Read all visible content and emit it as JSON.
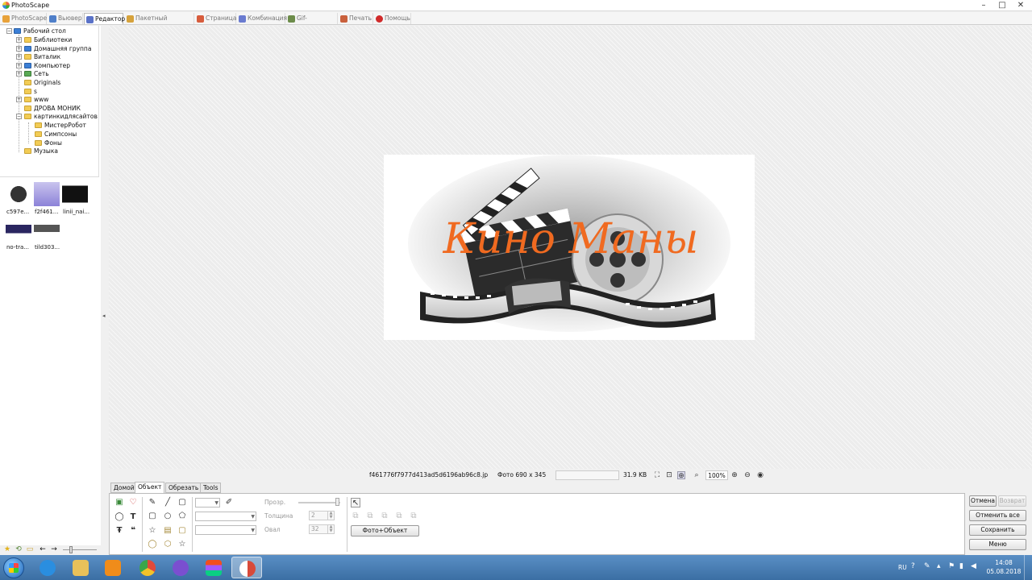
{
  "window": {
    "title": "PhotoScape",
    "min": "–",
    "max": "□",
    "close": "✕"
  },
  "tabs": [
    {
      "label": "PhotoScape",
      "icon": "photoscape-icon",
      "color": "#e8a23a"
    },
    {
      "label": "Вьювер",
      "icon": "viewer-icon",
      "color": "#4f7fc9"
    },
    {
      "label": "Редактор",
      "icon": "editor-icon",
      "color": "#5a72c8"
    },
    {
      "label": "Пакетный редактор",
      "icon": "batch-icon",
      "color": "#d6a23b"
    },
    {
      "label": "Страница",
      "icon": "page-icon",
      "color": "#d75c3c"
    },
    {
      "label": "Комбинация",
      "icon": "combine-icon",
      "color": "#6a7bd0"
    },
    {
      "label": "Gif-Анимация",
      "icon": "gif-icon",
      "color": "#6c8c4a"
    },
    {
      "label": "Печать",
      "icon": "print-icon",
      "color": "#c9603c"
    },
    {
      "label": "Помощь",
      "icon": "help-icon",
      "color": "#d02a2a"
    }
  ],
  "tree": [
    {
      "label": "Рабочий стол",
      "icon": "desktop-icon"
    },
    {
      "label": "Библиотеки",
      "icon": "libraries-icon"
    },
    {
      "label": "Домашняя группа",
      "icon": "homegroup-icon"
    },
    {
      "label": "Виталик",
      "icon": "user-folder-icon"
    },
    {
      "label": "Компьютер",
      "icon": "computer-icon"
    },
    {
      "label": "Сеть",
      "icon": "network-icon"
    },
    {
      "label": "Originals",
      "icon": "folder-icon"
    },
    {
      "label": "s",
      "icon": "folder-icon"
    },
    {
      "label": "www",
      "icon": "folder-icon"
    },
    {
      "label": "ДРОВА МОНИК",
      "icon": "folder-icon"
    },
    {
      "label": "картинкидлясайтов",
      "icon": "folder-icon"
    },
    {
      "label": "МистерРобот",
      "icon": "folder-icon"
    },
    {
      "label": "Симпсоны",
      "icon": "folder-icon"
    },
    {
      "label": "Фоны",
      "icon": "folder-icon"
    },
    {
      "label": "Музыка",
      "icon": "folder-icon"
    }
  ],
  "thumbnails": [
    {
      "label": "c597e..."
    },
    {
      "label": "f2f461..."
    },
    {
      "label": "linii_nai..."
    },
    {
      "label": "no-tra..."
    },
    {
      "label": "tild303..."
    }
  ],
  "status": {
    "filename": "f461776f7977d413ad5d6196ab96c8.jp",
    "dimensions": "Фото 690 x 345",
    "filesize": "31.9 KB",
    "zoom": "100%"
  },
  "editor_tabs": [
    "Домой",
    "Объект",
    "Обрезать",
    "Tools"
  ],
  "object_panel": {
    "transparency_label": "Прозр.",
    "thickness_label": "Толщина",
    "thickness_value": "2",
    "oval_label": "Овал",
    "oval_value": "32",
    "photo_object_button": "Фото+Объект"
  },
  "actions": {
    "undo": "Отмена",
    "redo": "Возврат",
    "undo_all": "Отменить все",
    "save": "Сохранить",
    "menu": "Меню"
  },
  "taskbar": {
    "lang": "RU",
    "time": "14:08",
    "date": "05.08.2018",
    "apps": [
      {
        "name": "ie-icon",
        "color": "#2a8ee0"
      },
      {
        "name": "explorer-icon",
        "color": "#e8c15a"
      },
      {
        "name": "media-player-icon",
        "color": "#f08c1a"
      },
      {
        "name": "chrome-icon",
        "color": "#e04a3a"
      },
      {
        "name": "viber-icon",
        "color": "#7a4fd0"
      },
      {
        "name": "figma-icon",
        "color": "#e85a2a"
      },
      {
        "name": "photoscape-icon",
        "color": "#d84a3a"
      }
    ]
  },
  "photo": {
    "logo_text": "Кино Маны",
    "accent": "#f06a20"
  }
}
